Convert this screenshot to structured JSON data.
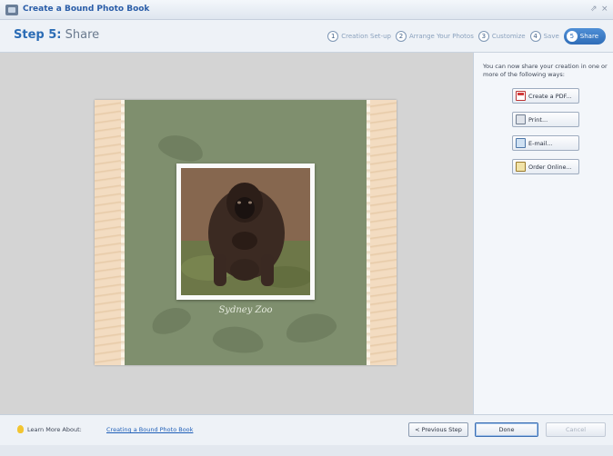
{
  "window": {
    "title": "Create a Bound Photo Book",
    "controls": [
      "restore-icon",
      "close-icon"
    ],
    "restore_glyph": "⇗",
    "close_glyph": "×"
  },
  "header": {
    "step_number": "Step 5:",
    "step_name": "Share",
    "steps": [
      {
        "num": "1",
        "label": "Creation Set-up",
        "active": false
      },
      {
        "num": "2",
        "label": "Arrange Your Photos",
        "active": false
      },
      {
        "num": "3",
        "label": "Customize",
        "active": false
      },
      {
        "num": "4",
        "label": "Save",
        "active": false
      },
      {
        "num": "5",
        "label": "Share",
        "active": true
      }
    ]
  },
  "preview": {
    "caption": "Sydney Zoo"
  },
  "share_panel": {
    "intro": "You can now share your creation in one or more of the following ways:",
    "buttons": [
      {
        "label": "Create a PDF...",
        "icon": "pdf-icon"
      },
      {
        "label": "Print...",
        "icon": "printer-icon"
      },
      {
        "label": "E-mail...",
        "icon": "email-icon"
      },
      {
        "label": "Order Online...",
        "icon": "order-online-icon"
      }
    ]
  },
  "footer": {
    "learn_label": "Learn More About:",
    "learn_link": "Creating a Bound Photo Book",
    "previous_label": "< Previous Step",
    "done_label": "Done",
    "cancel_label": "Cancel"
  },
  "colors": {
    "accent": "#2f6db8",
    "page_green": "#7f8f6e",
    "link": "#1f5fb8"
  }
}
